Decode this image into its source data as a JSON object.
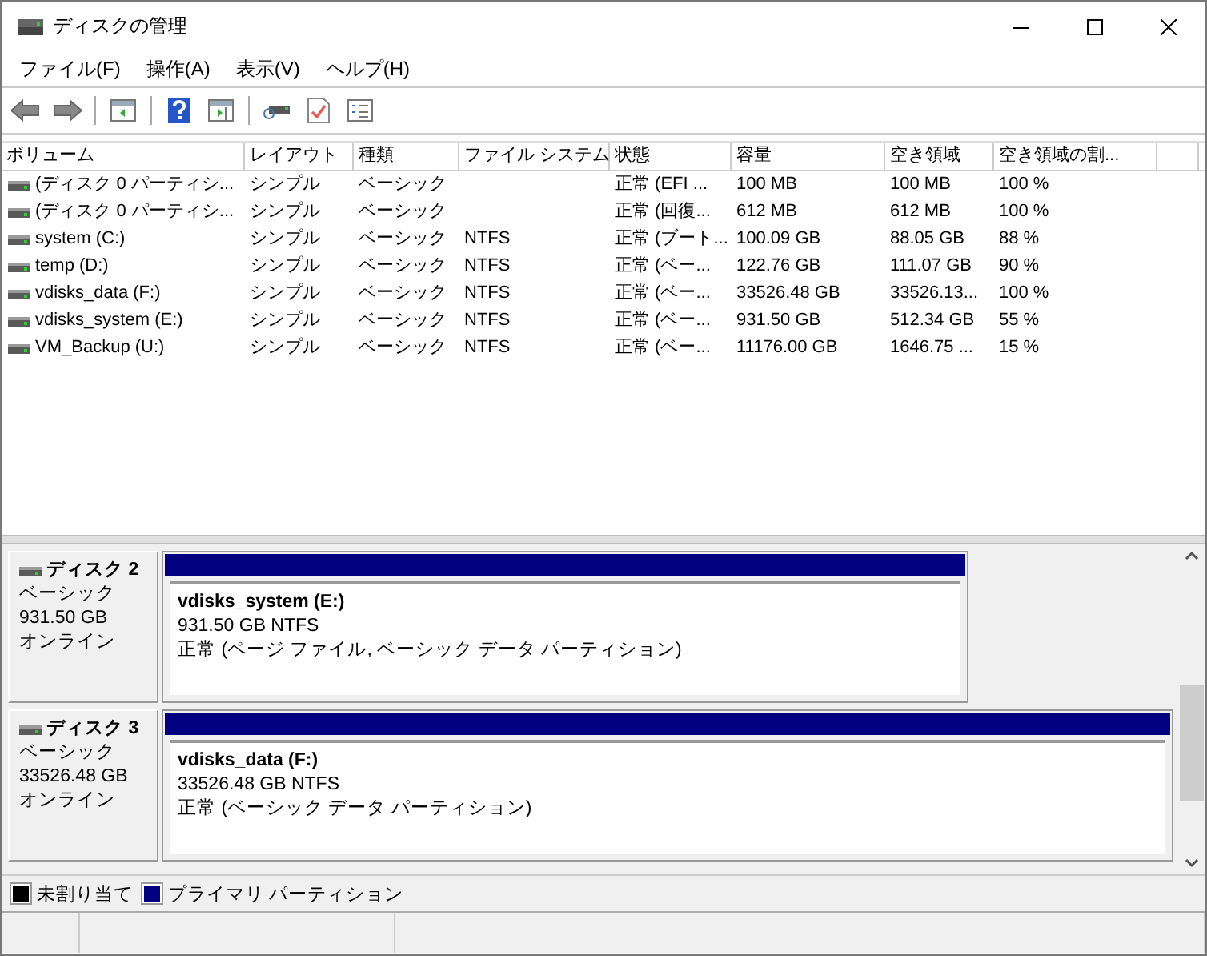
{
  "window": {
    "title": "ディスクの管理"
  },
  "menu": [
    "ファイル(F)",
    "操作(A)",
    "表示(V)",
    "ヘルプ(H)"
  ],
  "table": {
    "columns": [
      "ボリューム",
      "レイアウト",
      "種類",
      "ファイル システム",
      "状態",
      "容量",
      "空き領域",
      "空き領域の割..."
    ],
    "rows": [
      [
        "(ディスク 0 パーティシ...",
        "シンプル",
        "ベーシック",
        "",
        "正常 (EFI ...",
        "100 MB",
        "100 MB",
        "100 %"
      ],
      [
        "(ディスク 0 パーティシ...",
        "シンプル",
        "ベーシック",
        "",
        "正常 (回復...",
        "612 MB",
        "612 MB",
        "100 %"
      ],
      [
        "system (C:)",
        "シンプル",
        "ベーシック",
        "NTFS",
        "正常 (ブート...",
        "100.09 GB",
        "88.05 GB",
        "88 %"
      ],
      [
        "temp (D:)",
        "シンプル",
        "ベーシック",
        "NTFS",
        "正常 (ベー...",
        "122.76 GB",
        "111.07 GB",
        "90 %"
      ],
      [
        "vdisks_data (F:)",
        "シンプル",
        "ベーシック",
        "NTFS",
        "正常 (ベー...",
        "33526.48 GB",
        "33526.13...",
        "100 %"
      ],
      [
        "vdisks_system (E:)",
        "シンプル",
        "ベーシック",
        "NTFS",
        "正常 (ベー...",
        "931.50 GB",
        "512.34 GB",
        "55 %"
      ],
      [
        "VM_Backup (U:)",
        "シンプル",
        "ベーシック",
        "NTFS",
        "正常 (ベー...",
        "11176.00 GB",
        "1646.75 ...",
        "15 %"
      ]
    ]
  },
  "disks": [
    {
      "name": "ディスク 2",
      "type": "ベーシック",
      "size": "931.50 GB",
      "status": "オンライン",
      "partition": {
        "name": "vdisks_system  (E:)",
        "size": "931.50 GB NTFS",
        "status": "正常 (ページ ファイル, ベーシック データ パーティション)"
      }
    },
    {
      "name": "ディスク 3",
      "type": "ベーシック",
      "size": "33526.48 GB",
      "status": "オンライン",
      "partition": {
        "name": "vdisks_data  (F:)",
        "size": "33526.48 GB NTFS",
        "status": "正常 (ベーシック データ パーティション)"
      }
    }
  ],
  "legend": [
    {
      "label": "未割り当て",
      "color": "#000000"
    },
    {
      "label": "プライマリ パーティション",
      "color": "#000080"
    }
  ]
}
